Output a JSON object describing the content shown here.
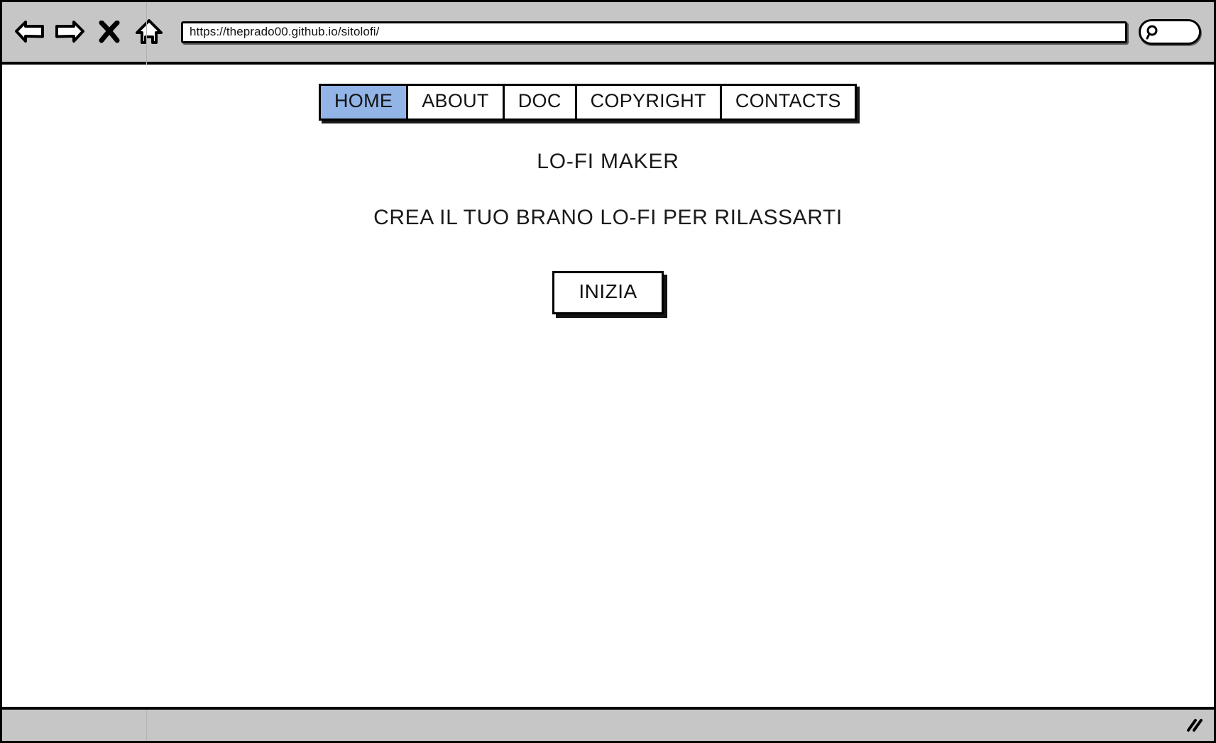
{
  "browser": {
    "toolbar": {
      "back_icon": "back-arrow-icon",
      "forward_icon": "forward-arrow-icon",
      "stop_icon": "stop-x-icon",
      "home_icon": "home-house-icon",
      "url_value": "https://theprado00.github.io/sitolofi/",
      "url_placeholder": "Enter URL",
      "search_icon": "magnifier-icon",
      "search_value": "",
      "search_placeholder": ""
    },
    "statusbar": {
      "resize_icon": "resize-grip-icon"
    },
    "chrome_color": "#c6c6c6",
    "border_color": "#000000"
  },
  "page": {
    "nav": {
      "items": [
        {
          "label": "HOME",
          "active": true
        },
        {
          "label": "ABOUT",
          "active": false
        },
        {
          "label": "DOC",
          "active": false
        },
        {
          "label": "COPYRIGHT",
          "active": false
        },
        {
          "label": "CONTACTS",
          "active": false
        }
      ],
      "active_color": "#93b4e6"
    },
    "hero": {
      "title": "LO-FI MAKER",
      "subtitle": "CREA IL TUO BRANO LO-FI PER RILASSARTI",
      "cta_label": "INIZIA"
    }
  }
}
